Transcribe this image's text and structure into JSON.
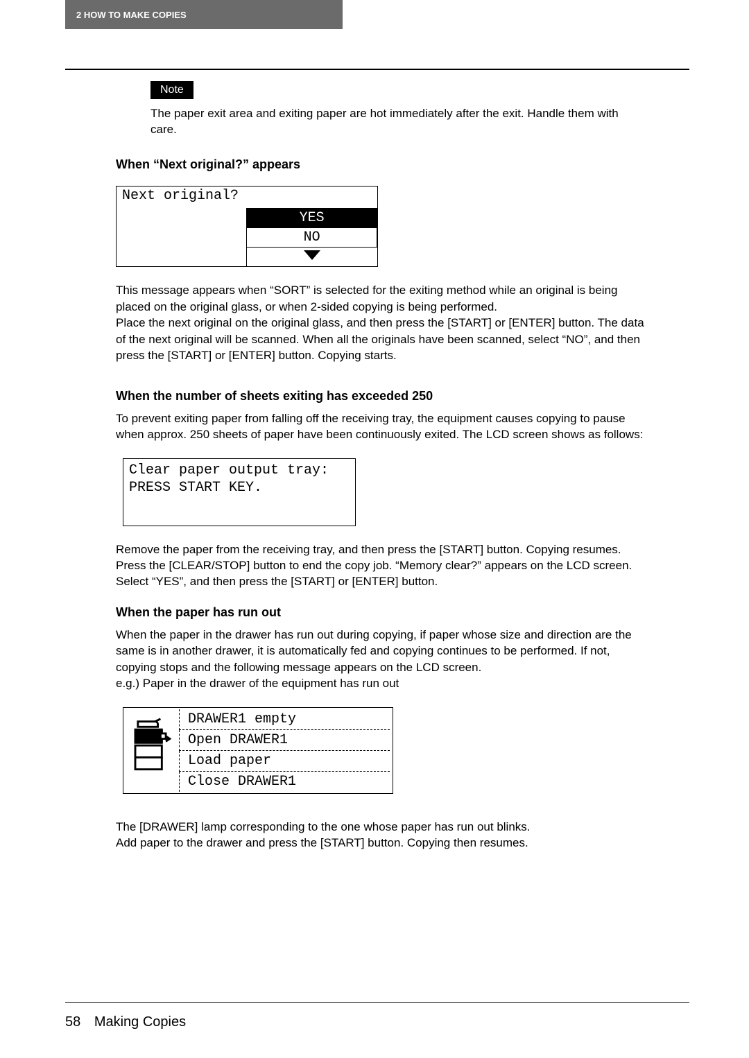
{
  "header": {
    "chapter_tab": "2   HOW TO MAKE COPIES"
  },
  "note": {
    "badge": "Note",
    "text": "The paper exit area and exiting paper are hot immediately after the exit. Handle them with care."
  },
  "section_next_original": {
    "heading": "When “Next original?” appears",
    "lcd": {
      "prompt": "Next original?",
      "yes": "YES",
      "no": "NO"
    },
    "para": "This message appears when “SORT” is selected for the exiting method while an original is being placed on the original glass, or when 2-sided copying is being performed.\nPlace the next original on the original glass, and then press the [START] or [ENTER] button. The data of the next original will be scanned. When all the originals have been scanned, select “NO”, and then press the [START] or [ENTER] button. Copying starts."
  },
  "section_sheets_exceeded": {
    "heading": "When the number of sheets exiting has exceeded 250",
    "intro": "To prevent exiting paper from falling off the receiving tray, the equipment causes copying to pause when approx. 250 sheets of paper have been continuously exited. The LCD screen shows as follows:",
    "lcd": {
      "line1": "Clear paper output tray:",
      "line2": "PRESS START KEY."
    },
    "para": "Remove the paper from the receiving tray, and then press the [START] button. Copying resumes.\nPress the [CLEAR/STOP] button to end the copy job. “Memory clear?” appears on the LCD screen. Select “YES”, and then press the [START] or [ENTER] button."
  },
  "section_paper_out": {
    "heading": "When the paper has run out",
    "intro": "When the paper in the drawer has run out during copying, if paper whose size and direction are the same is in another drawer, it is automatically fed and copying continues to be performed. If not, copying stops and the following message appears on the LCD screen.\ne.g.) Paper in the drawer of the equipment has run out",
    "lcd": {
      "line1": "DRAWER1 empty",
      "line2": "Open DRAWER1",
      "line3": "Load paper",
      "line4": "Close DRAWER1"
    },
    "para": "The [DRAWER] lamp corresponding to the one whose paper has run out blinks.\nAdd paper to the drawer and press the [START] button. Copying then resumes."
  },
  "footer": {
    "page_number": "58",
    "title": "Making Copies"
  }
}
